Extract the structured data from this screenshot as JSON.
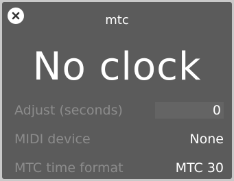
{
  "window": {
    "title": "mtc",
    "close_icon": "close-icon"
  },
  "clock": {
    "display": "No clock"
  },
  "settings": {
    "adjust": {
      "label": "Adjust (seconds)",
      "value": "0"
    },
    "midi_device": {
      "label": "MIDI device",
      "value": "None"
    },
    "time_format": {
      "label": "MTC time format",
      "value": "MTC 30"
    }
  }
}
